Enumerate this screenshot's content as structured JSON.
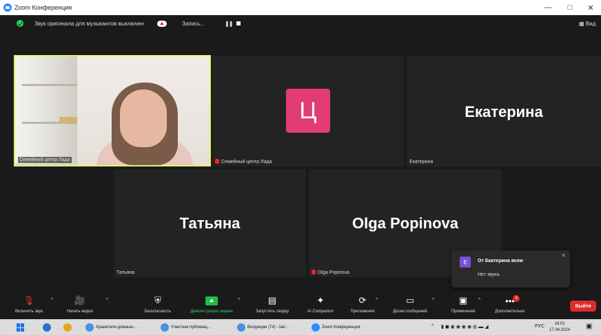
{
  "app": {
    "title": "Zoom Конференция"
  },
  "window_controls": {
    "minimize": "—",
    "maximize": "□",
    "close": "✕"
  },
  "topbar": {
    "original_sound": "Звук оригинала для музыкантов выключен",
    "record": "Запись...",
    "pause_glyph": "❚❚",
    "view": "Вид"
  },
  "tiles": {
    "me": {
      "name": "Семейный центр Лада"
    },
    "lada": {
      "avatar_letter": "Ц",
      "name": "Семейный центр Лада"
    },
    "ekaterina": {
      "big": "Екатерина",
      "name": "Екатерина"
    },
    "tatyana": {
      "big": "Татьяна",
      "name": "Татьяна"
    },
    "olga": {
      "big": "Olga Popinova",
      "name": "Olga Popinova"
    }
  },
  "notification": {
    "avatar_letter": "Е",
    "from": "От Екатерина всем",
    "message": "Нет звука.",
    "close": "✕"
  },
  "toolbar": {
    "unmute": "Включить звук",
    "start_video": "Начать видео",
    "security": "Безопасность",
    "share": "Демонстрация экрана",
    "summary": "Запустить сводку",
    "ai": "AI Companion",
    "apps": "Приложения",
    "whiteboards": "Доски сообщений",
    "notes": "Примечания",
    "more": "Дополнительно",
    "more_badge": "3",
    "leave": "Выйти",
    "caret": "^"
  },
  "taskbar": {
    "item1": "Хранители домашн...",
    "item2": "Участник публикац...",
    "item3": "Входящие (74) - lad...",
    "item4": "Zoom Конференция",
    "lang": "РУС",
    "time": "18:01",
    "date": "17.04.2024"
  },
  "colors": {
    "accent_active_border": "#e8f06a",
    "avatar_pink": "#e23c74",
    "leave_red": "#e02b2b",
    "share_green": "#1dbf4a",
    "zoom_blue": "#2d8cff"
  }
}
